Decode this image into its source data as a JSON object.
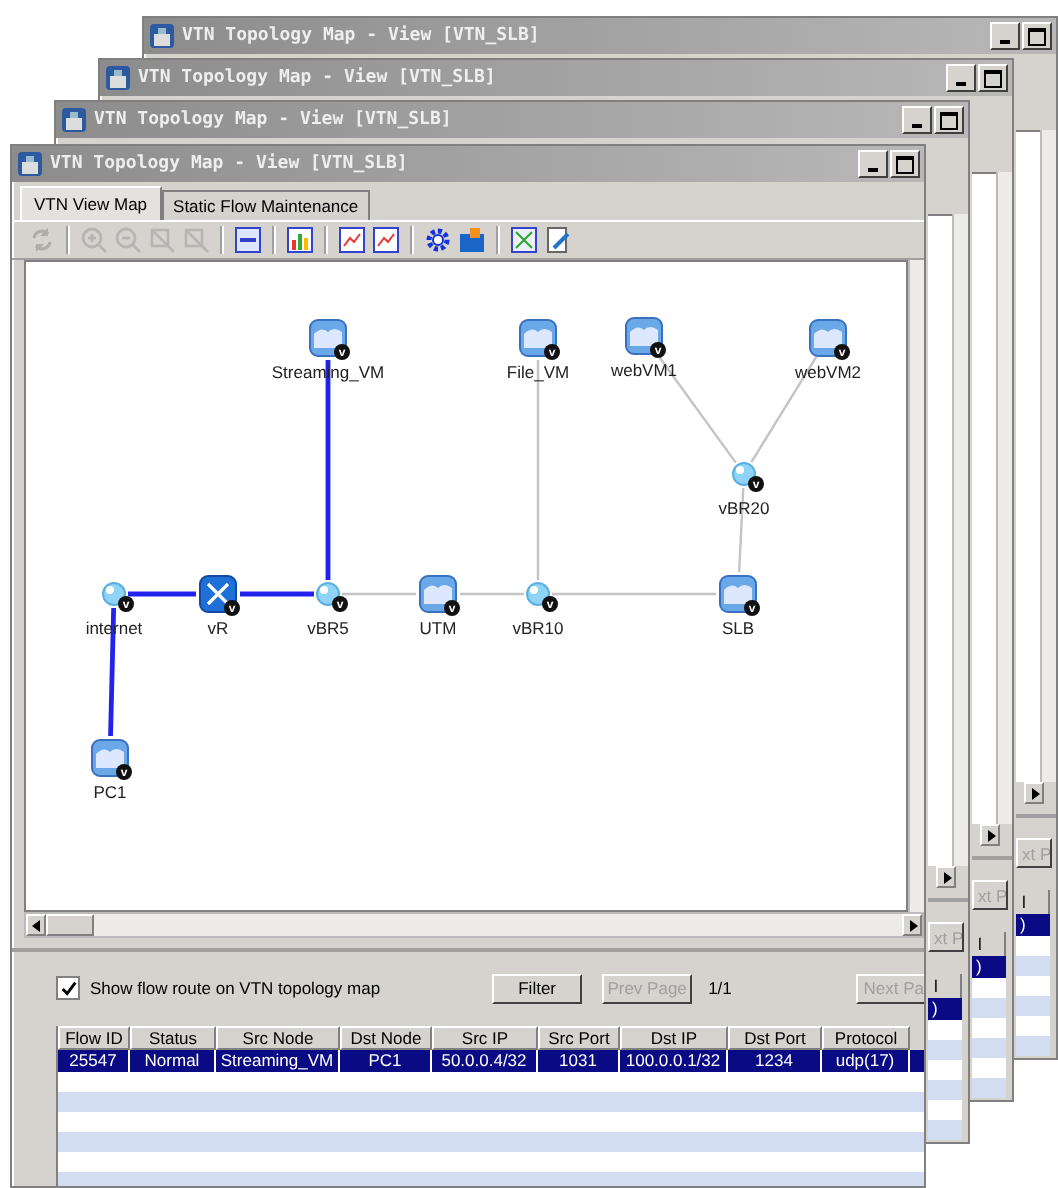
{
  "back_windows": [
    {
      "title": "VTN Topology Map - View [VTN_SLB]",
      "next_fragment": "xt P",
      "header_fragment": "l",
      "row_fragment": ")"
    },
    {
      "title": "VTN Topology Map - View [VTN_SLB]",
      "next_fragment": "xt P",
      "header_fragment": "l",
      "row_fragment": ")"
    },
    {
      "title": "VTN Topology Map - View [VTN_SLB]",
      "next_fragment": "xt P",
      "header_fragment": "l",
      "row_fragment": ")"
    }
  ],
  "window": {
    "title": "VTN Topology Map - View [VTN_SLB]"
  },
  "tabs": [
    {
      "label": "VTN View Map",
      "selected": true
    },
    {
      "label": "Static Flow Maintenance",
      "selected": false
    }
  ],
  "toolbar": [
    [
      {
        "disabled": true
      }
    ],
    [
      {
        "disabled": true
      },
      {
        "disabled": true
      },
      {
        "disabled": true
      },
      {
        "disabled": true
      }
    ],
    [
      {
        "disabled": false
      }
    ],
    [
      {
        "disabled": false
      }
    ],
    [
      {
        "disabled": false
      },
      {
        "disabled": false
      }
    ],
    [
      {
        "disabled": false
      },
      {
        "disabled": false
      }
    ],
    [
      {
        "disabled": false
      },
      {
        "disabled": false
      }
    ]
  ],
  "topology": {
    "nodes": [
      {
        "label": "Streaming_VM",
        "kind": "vm",
        "badge": "v"
      },
      {
        "label": "File_VM",
        "kind": "vm",
        "badge": "v"
      },
      {
        "label": "webVM1",
        "kind": "vm",
        "badge": "v"
      },
      {
        "label": "webVM2",
        "kind": "vm",
        "badge": "v"
      },
      {
        "label": "vBR20",
        "kind": "bridge",
        "badge": "v"
      },
      {
        "label": "internet",
        "kind": "bridge",
        "badge": "v"
      },
      {
        "label": "vR",
        "kind": "router",
        "badge": "v"
      },
      {
        "label": "vBR5",
        "kind": "bridge",
        "badge": "v"
      },
      {
        "label": "UTM",
        "kind": "vm",
        "badge": "v"
      },
      {
        "label": "vBR10",
        "kind": "bridge",
        "badge": "v"
      },
      {
        "label": "SLB",
        "kind": "vm",
        "badge": "v"
      },
      {
        "label": "PC1",
        "kind": "vm",
        "badge": "v"
      }
    ],
    "links": [
      {
        "highlighted": true
      },
      {
        "highlighted": true
      },
      {
        "highlighted": true
      },
      {
        "highlighted": true
      },
      {
        "highlighted": false
      },
      {
        "highlighted": false
      },
      {
        "highlighted": false
      },
      {
        "highlighted": false
      },
      {
        "highlighted": false
      },
      {
        "highlighted": false
      },
      {
        "highlighted": false
      }
    ]
  },
  "flow_panel": {
    "show_route": {
      "label": "Show flow route on VTN topology map",
      "checked": true
    },
    "filter_button": {
      "label": "Filter",
      "disabled": false
    },
    "prev_button": {
      "label": "Prev Page",
      "disabled": true
    },
    "page": "1/1",
    "next_button": {
      "label": "Next Pa",
      "disabled": true
    },
    "table": {
      "columns": [
        "Flow ID",
        "Status",
        "Src Node",
        "Dst Node",
        "Src IP",
        "Src Port",
        "Dst IP",
        "Dst Port",
        "Protocol"
      ],
      "rows": [
        {
          "cells": [
            "25547",
            "Normal",
            "Streaming_VM",
            "PC1",
            "50.0.0.4/32",
            "1031",
            "100.0.0.1/32",
            "1234",
            "udp(17)"
          ],
          "selected": true
        }
      ]
    }
  }
}
